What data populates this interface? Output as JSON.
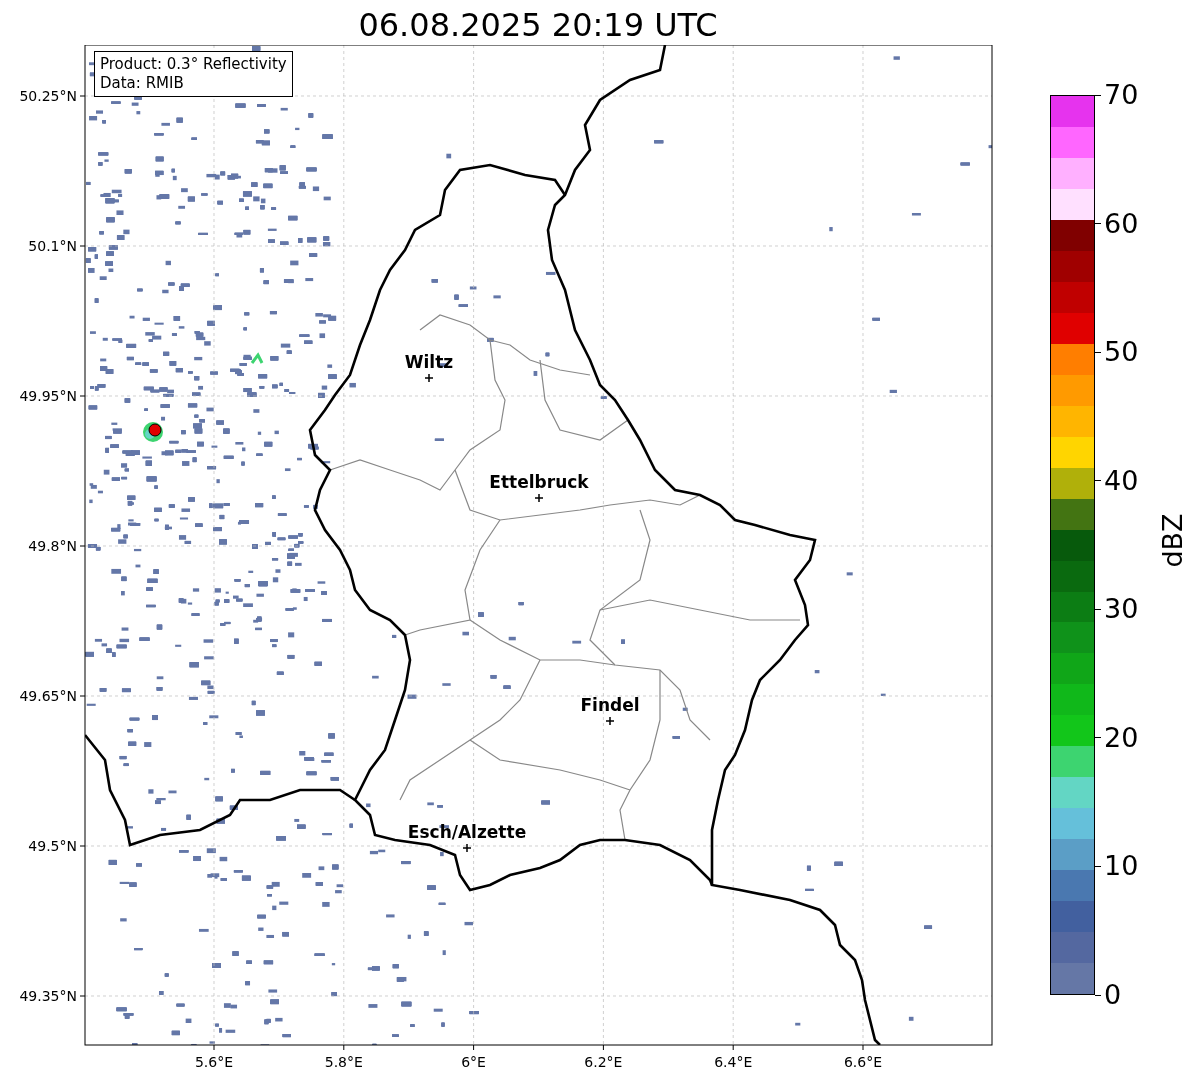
{
  "title": "06.08.2025 20:19 UTC",
  "legend": [
    "Product: 0.3° Reflectivity",
    "Data: RMIB"
  ],
  "map": {
    "cities": [
      "Wiltz",
      "Ettelbruck",
      "Findel",
      "Esch/Alzette"
    ],
    "latitude_labels": [
      "50.25°N",
      "50.1°N",
      "49.95°N",
      "49.8°N",
      "49.65°N",
      "49.5°N",
      "49.35°N"
    ],
    "longitude_labels": [
      "5.6°E",
      "5.8°E",
      "6°E",
      "6.2°E",
      "6.4°E",
      "6.6°E"
    ]
  },
  "colorbar": {
    "label": "dBZ",
    "ticks": [
      "70",
      "60",
      "50",
      "40",
      "30",
      "20",
      "10",
      "0"
    ],
    "segments": [
      {
        "color": "#e633ee"
      },
      {
        "color": "#ff66ff"
      },
      {
        "color": "#ffb0ff"
      },
      {
        "color": "#ffe0ff"
      },
      {
        "color": "#800000"
      },
      {
        "color": "#a00000"
      },
      {
        "color": "#c00000"
      },
      {
        "color": "#e00000"
      },
      {
        "color": "#ff7e00"
      },
      {
        "color": "#ff9a00"
      },
      {
        "color": "#ffb500"
      },
      {
        "color": "#ffd500"
      },
      {
        "color": "#b0b00a"
      },
      {
        "color": "#437412"
      },
      {
        "color": "#075a0c"
      },
      {
        "color": "#0a6a0f"
      },
      {
        "color": "#0c7d14"
      },
      {
        "color": "#0f921a"
      },
      {
        "color": "#10a618"
      },
      {
        "color": "#10b81a"
      },
      {
        "color": "#12c61a"
      },
      {
        "color": "#3dd470"
      },
      {
        "color": "#63d6c4"
      },
      {
        "color": "#65c0da"
      },
      {
        "color": "#5b9ec6"
      },
      {
        "color": "#4a78b0"
      },
      {
        "color": "#42609f"
      },
      {
        "color": "#5468a0"
      },
      {
        "color": "#6577a6"
      }
    ]
  }
}
